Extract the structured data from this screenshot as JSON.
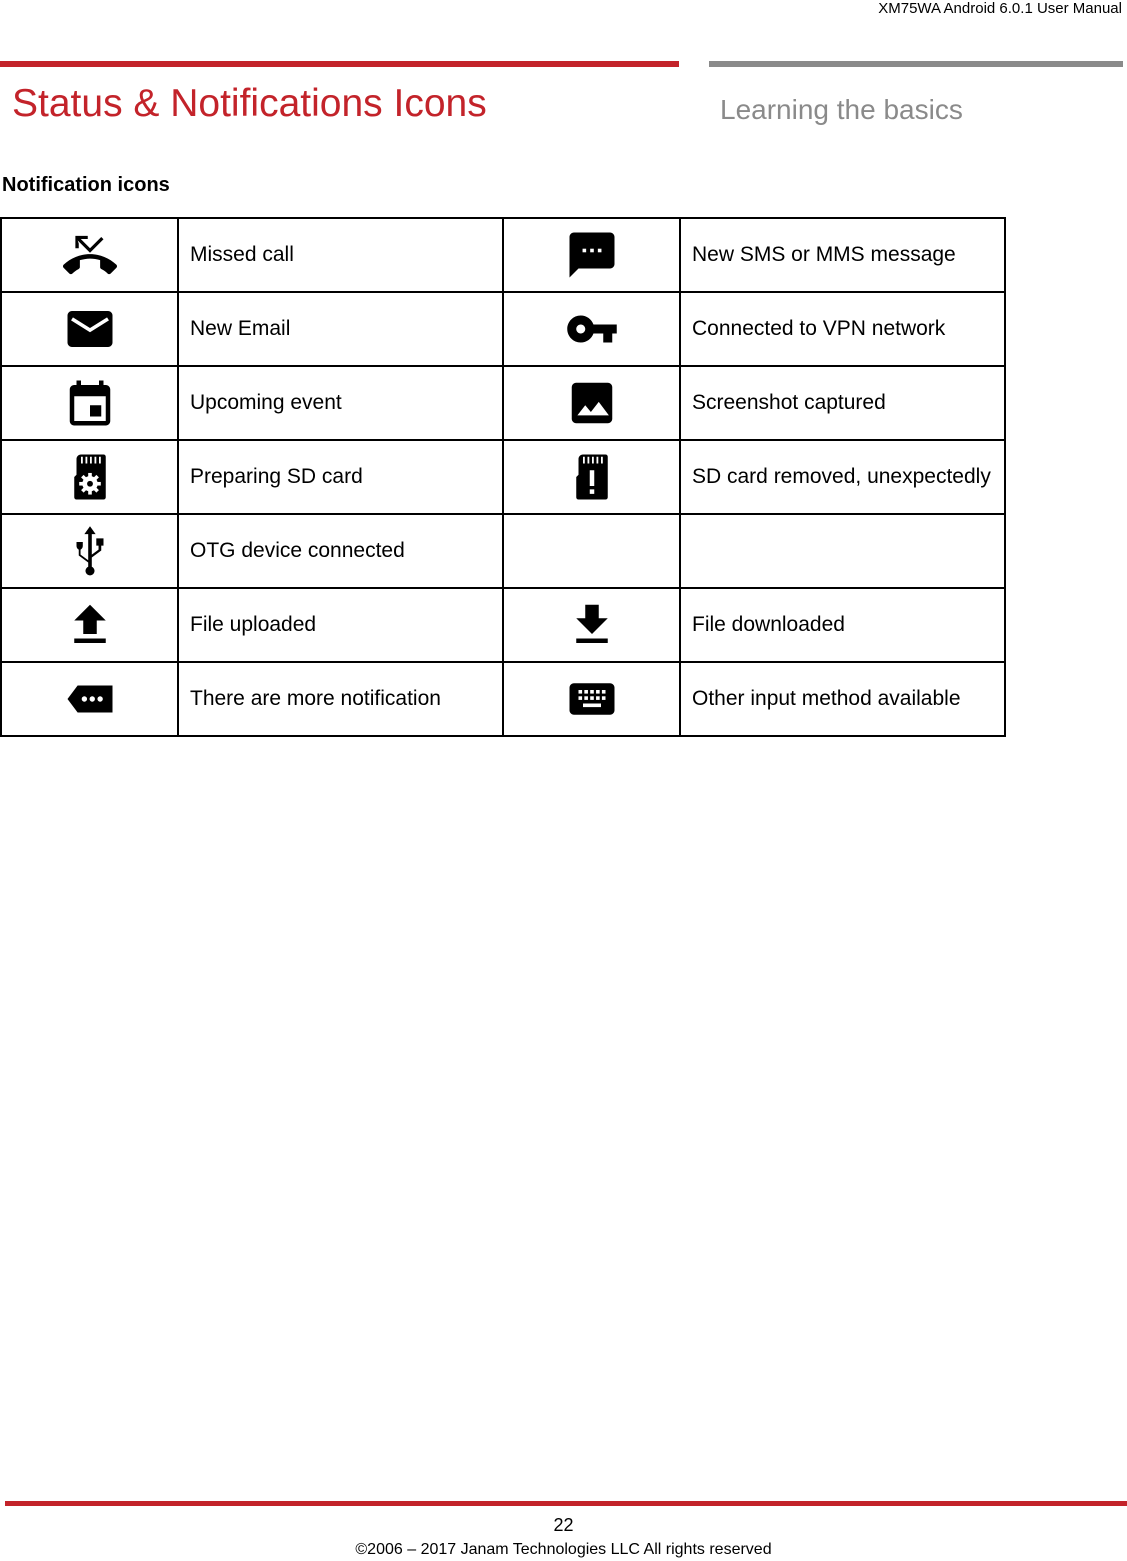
{
  "header": {
    "doc_title": "XM75WA Android 6.0.1 User Manual",
    "page_title": "Status & Notifications Icons",
    "section_name": "Learning the basics"
  },
  "colors": {
    "accent_red": "#c3232a",
    "section_gray": "#8a8a8a"
  },
  "content": {
    "subheading": "Notification icons",
    "rows": [
      {
        "left": {
          "icon": "missed-call-icon",
          "label": "Missed call"
        },
        "right": {
          "icon": "sms-message-icon",
          "label": "New SMS or MMS message"
        }
      },
      {
        "left": {
          "icon": "email-icon",
          "label": "New Email"
        },
        "right": {
          "icon": "vpn-key-icon",
          "label": "Connected to VPN network"
        }
      },
      {
        "left": {
          "icon": "calendar-event-icon",
          "label": "Upcoming event"
        },
        "right": {
          "icon": "image-icon",
          "label": "Screenshot captured"
        }
      },
      {
        "left": {
          "icon": "sd-card-settings-icon",
          "label": "Preparing SD card"
        },
        "right": {
          "icon": "sd-card-alert-icon",
          "label": "SD card  removed, unexpectedly"
        }
      },
      {
        "left": {
          "icon": "usb-icon",
          "label": "OTG device connected"
        },
        "right": {
          "icon": "",
          "label": ""
        }
      },
      {
        "left": {
          "icon": "upload-icon",
          "label": "File uploaded"
        },
        "right": {
          "icon": "download-icon",
          "label": "File downloaded"
        }
      },
      {
        "left": {
          "icon": "more-notifications-icon",
          "label": "There are more notification"
        },
        "right": {
          "icon": "keyboard-icon",
          "label": "Other input method available"
        }
      }
    ]
  },
  "footer": {
    "page_number": "22",
    "copyright": "©2006 – 2017 Janam Technologies LLC All rights reserved"
  }
}
